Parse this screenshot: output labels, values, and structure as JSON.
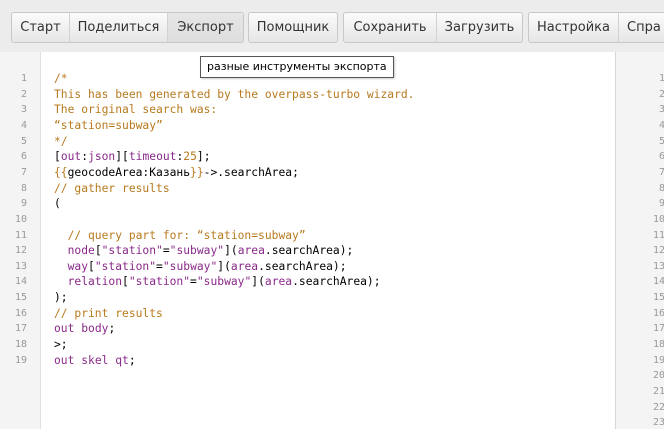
{
  "toolbar": {
    "group1": [
      "Старт",
      "Поделиться",
      "Экспорт"
    ],
    "group2": [
      "Помощник"
    ],
    "group3": [
      "Сохранить",
      "Загрузить"
    ],
    "group4": [
      "Настройка",
      "Спра"
    ]
  },
  "tooltip": {
    "text": "разные инструменты экспорта"
  },
  "editor": {
    "line_numbers": [
      "1",
      "2",
      "3",
      "4",
      "5",
      "6",
      "7",
      "8",
      "9",
      "10",
      "11",
      "12",
      "13",
      "14",
      "15",
      "16",
      "17",
      "18",
      "19"
    ],
    "lines": [
      [
        [
          "c-comment",
          "/*"
        ]
      ],
      [
        [
          "c-comment",
          "This has been generated by the overpass-turbo wizard."
        ]
      ],
      [
        [
          "c-comment",
          "The original search was:"
        ]
      ],
      [
        [
          "c-comment",
          "“station=subway”"
        ]
      ],
      [
        [
          "c-comment",
          "*/"
        ]
      ],
      [
        [
          "",
          "["
        ],
        [
          "c-key",
          "out"
        ],
        [
          "",
          ":"
        ],
        [
          "c-key",
          "json"
        ],
        [
          "",
          "]["
        ],
        [
          "c-key",
          "timeout"
        ],
        [
          "",
          ":"
        ],
        [
          "c-num",
          "25"
        ],
        [
          "",
          "];"
        ]
      ],
      [
        [
          "c-tmpl",
          "{{"
        ],
        [
          "",
          "geocodeArea:Казань"
        ],
        [
          "c-tmpl",
          "}}"
        ],
        [
          "",
          "->.searchArea;"
        ]
      ],
      [
        [
          "c-comment",
          "// gather results"
        ]
      ],
      [
        [
          "",
          "("
        ]
      ],
      [
        [
          "",
          ""
        ]
      ],
      [
        [
          "c-comment",
          "  // query part for: “station=subway”"
        ]
      ],
      [
        [
          "c-key",
          "  node"
        ],
        [
          "",
          "["
        ],
        [
          "c-str",
          "\"station\""
        ],
        [
          "",
          "="
        ],
        [
          "c-str",
          "\"subway\""
        ],
        [
          "",
          "]("
        ],
        [
          "c-key",
          "area"
        ],
        [
          "",
          ".searchArea);"
        ]
      ],
      [
        [
          "c-key",
          "  way"
        ],
        [
          "",
          "["
        ],
        [
          "c-str",
          "\"station\""
        ],
        [
          "",
          "="
        ],
        [
          "c-str",
          "\"subway\""
        ],
        [
          "",
          "]("
        ],
        [
          "c-key",
          "area"
        ],
        [
          "",
          ".searchArea);"
        ]
      ],
      [
        [
          "c-key",
          "  relation"
        ],
        [
          "",
          "["
        ],
        [
          "c-str",
          "\"station\""
        ],
        [
          "",
          "="
        ],
        [
          "c-str",
          "\"subway\""
        ],
        [
          "",
          "]("
        ],
        [
          "c-key",
          "area"
        ],
        [
          "",
          ".searchArea);"
        ]
      ],
      [
        [
          "",
          ");"
        ]
      ],
      [
        [
          "c-comment",
          "// print results"
        ]
      ],
      [
        [
          "c-key",
          "out"
        ],
        [
          "",
          " "
        ],
        [
          "c-key",
          "body"
        ],
        [
          "",
          ";"
        ]
      ],
      [
        [
          "",
          ">;"
        ]
      ],
      [
        [
          "c-key",
          "out"
        ],
        [
          "",
          " "
        ],
        [
          "c-key",
          "skel"
        ],
        [
          "",
          " "
        ],
        [
          "c-key",
          "qt"
        ],
        [
          "",
          ";"
        ]
      ]
    ]
  },
  "right_panel": {
    "line_numbers": [
      "1",
      "2",
      "3",
      "4",
      "5",
      "6",
      "7",
      "8",
      "9",
      "10",
      "11",
      "12",
      "13",
      "14",
      "15",
      "16",
      "17",
      "18",
      "19",
      "20",
      "21",
      "22",
      "23"
    ]
  }
}
